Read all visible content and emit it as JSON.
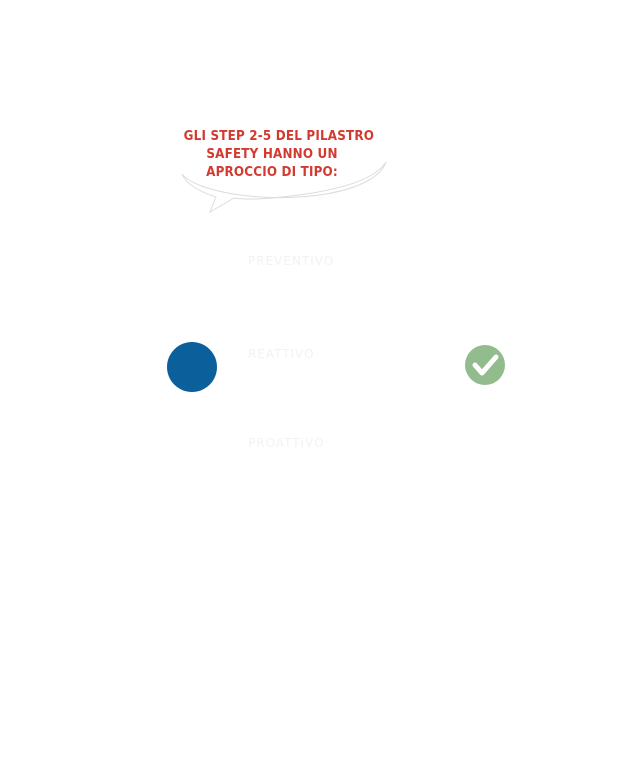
{
  "callout": {
    "lines": [
      "GLI STEP 2-5 DEL PILASTRO",
      "SAFETY HANNO UN",
      "APROCCIO DI TIPO:"
    ]
  },
  "steps": [
    {
      "label": "PREVENTIVO"
    },
    {
      "label": "REATTIVO",
      "marker": "blue-dot"
    },
    {
      "label": "PROATTIVO"
    }
  ],
  "indicator": {
    "icon": "check-circle-icon",
    "color": "#92bb8e"
  },
  "colors": {
    "callout_text": "#d23a2f",
    "dot": "#0b5f9a",
    "check": "#92bb8e"
  }
}
